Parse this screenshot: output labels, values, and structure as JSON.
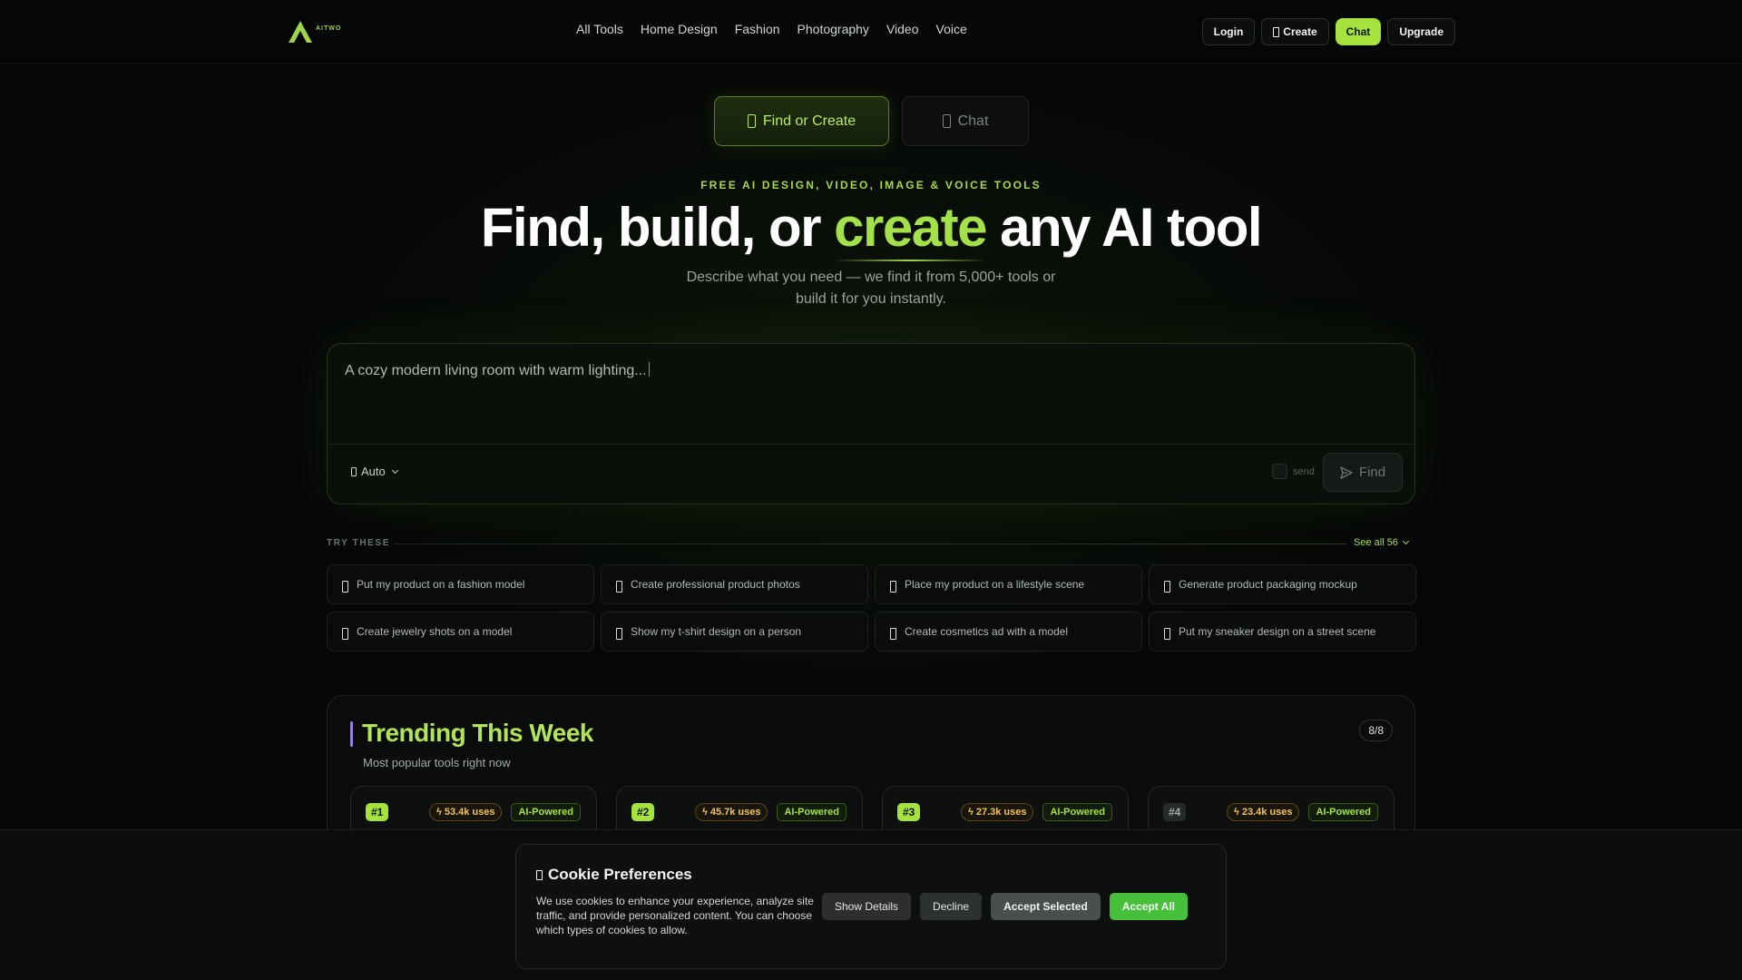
{
  "brand": {
    "logo_text": "AITWO",
    "accent_color": "#a5e23e"
  },
  "nav": {
    "links": [
      "All Tools",
      "Home Design",
      "Fashion",
      "Photography",
      "Video",
      "Voice"
    ],
    "login": "Login",
    "create": "Create",
    "chat": "Chat",
    "upgrade": "Upgrade"
  },
  "mode_toggle": {
    "active": "Find or Create",
    "inactive": "Chat"
  },
  "hero": {
    "eyebrow": "FREE AI DESIGN, VIDEO, IMAGE & VOICE TOOLS",
    "headline_before": "Find, build, or ",
    "headline_accent": "create",
    "headline_after": " any AI tool",
    "subhead": "Describe what you need — we find it from 5,000+ tools or build it for you instantly."
  },
  "prompt": {
    "value": "A cozy modern living room with warm lighting...",
    "mode": "Auto",
    "send_hint": "send",
    "find_label": "Find"
  },
  "try_these": {
    "label": "TRY THESE",
    "see_all": "See all 56",
    "chips": [
      "Put my product on a fashion model",
      "Create professional product photos",
      "Place my product on a lifestyle scene",
      "Generate product packaging mockup",
      "Create jewelry shots on a model",
      "Show my t-shirt design on a person",
      "Create cosmetics ad with a model",
      "Put my sneaker design on a street scene"
    ]
  },
  "trending": {
    "title": "Trending This Week",
    "subtitle": "Most popular tools right now",
    "count": "8/8",
    "cards": [
      {
        "rank": "#1",
        "uses": "53.4k uses",
        "badge": "AI-Powered"
      },
      {
        "rank": "#2",
        "uses": "45.7k uses",
        "badge": "AI-Powered"
      },
      {
        "rank": "#3",
        "uses": "27.3k uses",
        "badge": "AI-Powered"
      },
      {
        "rank": "#4",
        "uses": "23.4k uses",
        "badge": "AI-Powered"
      }
    ]
  },
  "cookie": {
    "title": "Cookie Preferences",
    "text": "We use cookies to enhance your experience, analyze site traffic, and provide personalized content. You can choose which types of cookies to allow.",
    "show_details": "Show Details",
    "decline": "Decline",
    "accept_selected": "Accept Selected",
    "accept_all": "Accept All"
  }
}
